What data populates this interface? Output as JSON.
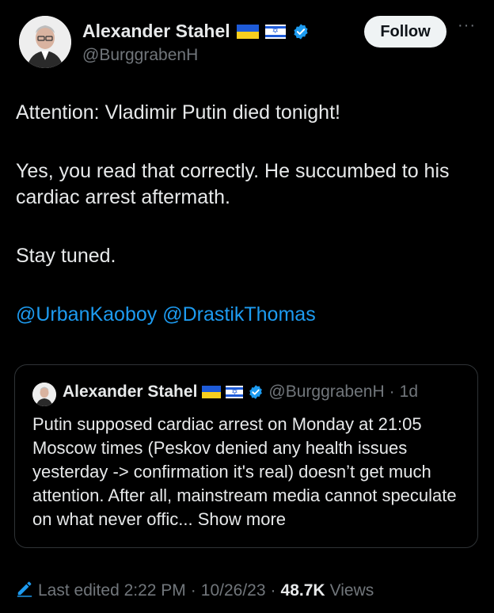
{
  "author": {
    "name": "Alexander Stahel",
    "handle": "@BurggrabenH"
  },
  "follow_label": "Follow",
  "more_label": "···",
  "tweet": {
    "line1": "Attention: Vladimir Putin died tonight!",
    "line2": "Yes, you read that correctly. He succumbed to his cardiac arrest aftermath.",
    "line3": "Stay tuned.",
    "mention1": "@UrbanKaoboy",
    "mention2": "@DrastikThomas"
  },
  "quote": {
    "name": "Alexander Stahel",
    "handle": "@BurggrabenH",
    "separator": "·",
    "age": "1d",
    "text": "Putin supposed cardiac arrest on Monday at 21:05 Moscow times (Peskov denied any health issues yesterday -> confirmation it's real) doesn’t get much attention. After all, mainstream media cannot speculate on what never offic...",
    "show_more": "Show more"
  },
  "footer": {
    "edited": "Last edited 2:22 PM",
    "separator": "·",
    "date": "10/26/23",
    "views_count": "48.7K",
    "views_label": "Views"
  },
  "colors": {
    "background": "#000000",
    "link": "#1d9bf0",
    "verified": "#1d9bf0",
    "muted": "#71767b",
    "flag_blue": "#1e5bd8",
    "flag_yellow": "#f8cf1e"
  },
  "icons": [
    "avatar",
    "ukraine-flag-icon",
    "israel-flag-icon",
    "verified-badge-icon",
    "more-icon",
    "edit-pencil-icon"
  ]
}
